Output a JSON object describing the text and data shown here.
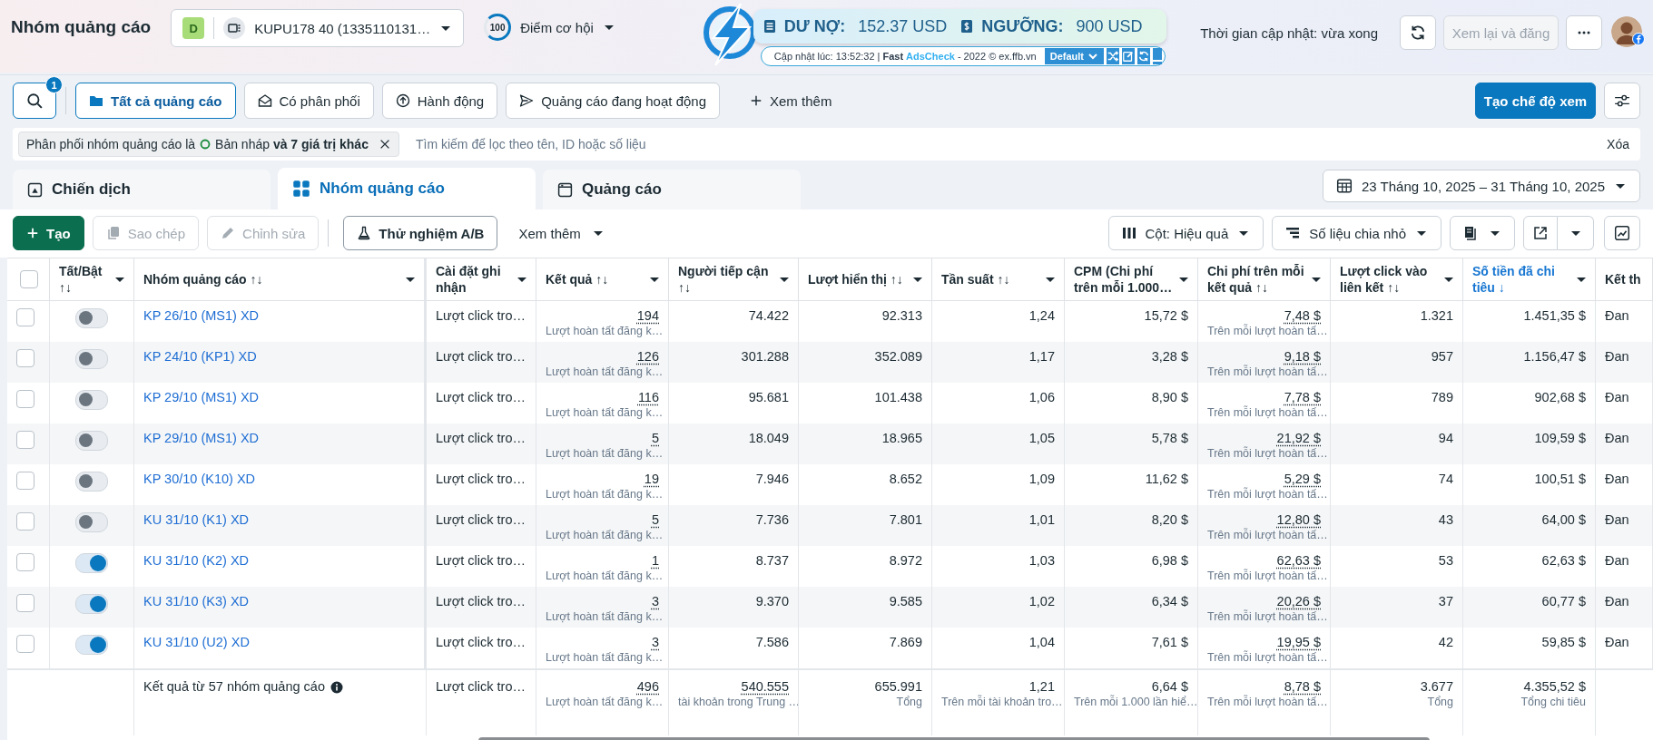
{
  "header": {
    "title": "Nhóm quảng cáo",
    "account": {
      "badge": "D",
      "name": "KUPU178 40 (1335110131…"
    },
    "score": {
      "value": "100",
      "label": "Điểm cơ hội"
    },
    "extension": {
      "debt_label": "DƯ NỢ:",
      "debt": "152.37 USD",
      "threshold_label": "NGƯỠNG:",
      "threshold": "900 USD",
      "updated": "Cập nhật lúc: 13:52:32 |",
      "brand_a": "Fast",
      "brand_b": "AdsCheck",
      "copyright": "- 2022 © ex.ffb.vn",
      "profile": "Default"
    },
    "update_time": "Thời gian cập nhật: vừa xong",
    "review_button": {
      "label": "Xem lại và đăng",
      "disabled": true
    }
  },
  "views": {
    "search_badge": "1",
    "items": [
      {
        "label": "Tất cả quảng cáo",
        "selected": true
      },
      {
        "label": "Có phân phối",
        "selected": false
      },
      {
        "label": "Hành động",
        "selected": false
      },
      {
        "label": "Quảng cáo đang hoạt động",
        "selected": false
      }
    ],
    "more": "Xem thêm",
    "create_view": "Tạo chế độ xem"
  },
  "filter_bar": {
    "chip_text": "Phân phối nhóm quảng cáo là",
    "chip_value": "Bản nháp **và 7 giá trị khác**",
    "placeholder": "Tìm kiếm để lọc theo tên, ID hoặc số liệu",
    "clear": "Xóa"
  },
  "tabs": [
    {
      "label": "Chiến dịch",
      "selected": false
    },
    {
      "label": "Nhóm quảng cáo",
      "selected": true
    },
    {
      "label": "Quảng cáo",
      "selected": false
    }
  ],
  "date_range": "23 Tháng 10, 2025 – 31 Tháng 10, 2025",
  "actions": [
    {
      "label": "Tạo",
      "kind": "primary"
    },
    {
      "label": "Sao chép",
      "kind": "disabled"
    },
    {
      "label": "Chỉnh sửa",
      "kind": "disabled"
    },
    {
      "label": "Thử nghiệm A/B",
      "kind": "outline"
    },
    {
      "label": "Xem thêm",
      "kind": "menu"
    }
  ],
  "right_actions": [
    {
      "label": "Cột: Hiệu quả"
    },
    {
      "label": "Số liệu chia nhỏ"
    }
  ],
  "table": {
    "select_all_checked": false,
    "columns": [
      {
        "label": "Tất/Bật\n↑↓",
        "sorted": false
      },
      {
        "label": "Nhóm quảng cáo ↑↓",
        "sorted": false
      },
      {
        "label": "Cài đặt ghi nhận",
        "sorted": false
      },
      {
        "label": "Kết quả ↑↓",
        "sorted": false
      },
      {
        "label": "Người tiếp cận ↑↓",
        "sorted": false
      },
      {
        "label": "Lượt hiển thị ↑↓",
        "sorted": false
      },
      {
        "label": "Tần suất ↑↓",
        "sorted": false
      },
      {
        "label": "CPM (Chi phí trên mỗi 1.000…",
        "sorted": false
      },
      {
        "label": "Chi phí trên mỗi kết quả ↑↓",
        "sorted": false
      },
      {
        "label": "Lượt click vào liên kết ↑↓",
        "sorted": false
      },
      {
        "label": "Số tiền đã chi tiêu ↓",
        "sorted": true
      },
      {
        "label": "Kết th",
        "sorted": false
      }
    ],
    "rows": [
      {
        "checked": false,
        "on": false,
        "name": "KP 26/10 (MS1) XD",
        "setting": "Lượt click tro…",
        "result": "194",
        "result_sub": "Lượt hoàn tất đăng k…",
        "reach": "74.422",
        "impressions": "92.313",
        "frequency": "1,24",
        "cpm": "15,72 $",
        "cost": "7,48 $",
        "cost_sub": "Trên mỗi lượt hoàn tấ…",
        "clicks": "1.321",
        "spent": "1.451,35 $",
        "end": "Đan"
      },
      {
        "checked": false,
        "on": false,
        "name": "KP 24/10 (KP1) XD",
        "setting": "Lượt click tro…",
        "result": "126",
        "result_sub": "Lượt hoàn tất đăng k…",
        "reach": "301.288",
        "impressions": "352.089",
        "frequency": "1,17",
        "cpm": "3,28 $",
        "cost": "9,18 $",
        "cost_sub": "Trên mỗi lượt hoàn tấ…",
        "clicks": "957",
        "spent": "1.156,47 $",
        "end": "Đan"
      },
      {
        "checked": false,
        "on": false,
        "name": "KP 29/10 (MS1) XD",
        "setting": "Lượt click tro…",
        "result": "116",
        "result_sub": "Lượt hoàn tất đăng k…",
        "reach": "95.681",
        "impressions": "101.438",
        "frequency": "1,06",
        "cpm": "8,90 $",
        "cost": "7,78 $",
        "cost_sub": "Trên mỗi lượt hoàn tấ…",
        "clicks": "789",
        "spent": "902,68 $",
        "end": "Đan"
      },
      {
        "checked": false,
        "on": false,
        "name": "KP 29/10 (MS1) XD",
        "setting": "Lượt click tro…",
        "result": "5",
        "result_sub": "Lượt hoàn tất đăng k…",
        "reach": "18.049",
        "impressions": "18.965",
        "frequency": "1,05",
        "cpm": "5,78 $",
        "cost": "21,92 $",
        "cost_sub": "Trên mỗi lượt hoàn tấ…",
        "clicks": "94",
        "spent": "109,59 $",
        "end": "Đan"
      },
      {
        "checked": false,
        "on": false,
        "name": "KP 30/10 (K10) XD",
        "setting": "Lượt click tro…",
        "result": "19",
        "result_sub": "Lượt hoàn tất đăng k…",
        "reach": "7.946",
        "impressions": "8.652",
        "frequency": "1,09",
        "cpm": "11,62 $",
        "cost": "5,29 $",
        "cost_sub": "Trên mỗi lượt hoàn tấ…",
        "clicks": "74",
        "spent": "100,51 $",
        "end": "Đan"
      },
      {
        "checked": false,
        "on": false,
        "name": "KU 31/10 (K1) XD",
        "setting": "Lượt click tro…",
        "result": "5",
        "result_sub": "Lượt hoàn tất đăng k…",
        "reach": "7.736",
        "impressions": "7.801",
        "frequency": "1,01",
        "cpm": "8,20 $",
        "cost": "12,80 $",
        "cost_sub": "Trên mỗi lượt hoàn tấ…",
        "clicks": "43",
        "spent": "64,00 $",
        "end": "Đan"
      },
      {
        "checked": false,
        "on": true,
        "name": "KU 31/10 (K2) XD",
        "setting": "Lượt click tro…",
        "result": "1",
        "result_sub": "Lượt hoàn tất đăng k…",
        "reach": "8.737",
        "impressions": "8.972",
        "frequency": "1,03",
        "cpm": "6,98 $",
        "cost": "62,63 $",
        "cost_sub": "Trên mỗi lượt hoàn tấ…",
        "clicks": "53",
        "spent": "62,63 $",
        "end": "Đan"
      },
      {
        "checked": false,
        "on": true,
        "name": "KU 31/10 (K3) XD",
        "setting": "Lượt click tro…",
        "result": "3",
        "result_sub": "Lượt hoàn tất đăng k…",
        "reach": "9.370",
        "impressions": "9.585",
        "frequency": "1,02",
        "cpm": "6,34 $",
        "cost": "20,26 $",
        "cost_sub": "Trên mỗi lượt hoàn tấ…",
        "clicks": "37",
        "spent": "60,77 $",
        "end": "Đan"
      },
      {
        "checked": false,
        "on": true,
        "name": "KU 31/10 (U2) XD",
        "setting": "Lượt click tro…",
        "result": "3",
        "result_sub": "Lượt hoàn tất đăng k…",
        "reach": "7.586",
        "impressions": "7.869",
        "frequency": "1,04",
        "cpm": "7,61 $",
        "cost": "19,95 $",
        "cost_sub": "Trên mỗi lượt hoàn tấ…",
        "clicks": "42",
        "spent": "59,85 $",
        "end": "Đan"
      }
    ],
    "footer": {
      "label": "Kết quả từ 57 nhóm quảng cáo",
      "setting": "Lượt click tro…",
      "result": "496",
      "result_sub": "Lượt hoàn tất đăng k…",
      "reach": "540.555",
      "reach_sub": "tài khoản trong Trung …",
      "impressions": "655.991",
      "impressions_sub": "Tổng",
      "frequency": "1,21",
      "frequency_sub": "Trên mỗi tài khoản tro…",
      "cpm": "6,64 $",
      "cpm_sub": "Trên mỗi 1.000 lần hiể…",
      "cost": "8,78 $",
      "cost_sub": "Trên mỗi lượt hoàn tấ…",
      "clicks": "3.677",
      "clicks_sub": "Tổng",
      "spent": "4.355,52 $",
      "spent_sub": "Tổng chi tiêu"
    }
  }
}
